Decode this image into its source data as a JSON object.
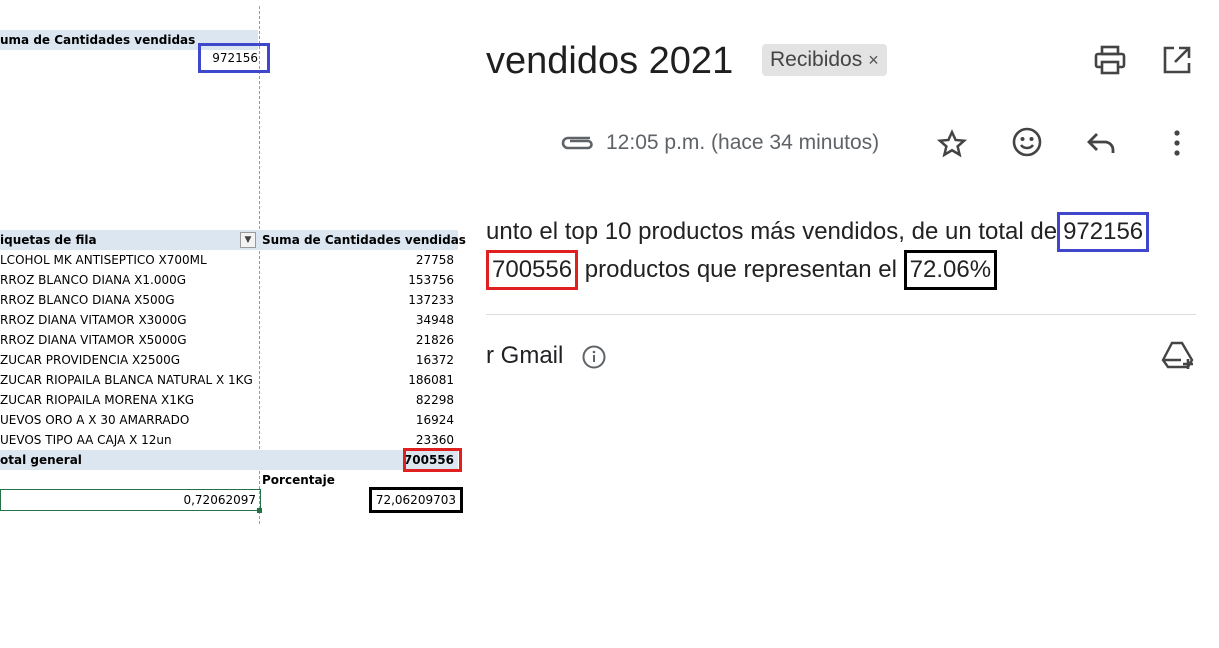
{
  "excel": {
    "top_header": "uma de Cantidades vendidas",
    "top_value": "972156",
    "pivot_header_left": "iquetas de fila",
    "pivot_header_right": "Suma de Cantidades vendidas",
    "rows": [
      {
        "label": "LCOHOL MK ANTISEPTICO X700ML",
        "value": "27758"
      },
      {
        "label": "RROZ BLANCO DIANA X1.000G",
        "value": "153756"
      },
      {
        "label": "RROZ BLANCO DIANA X500G",
        "value": "137233"
      },
      {
        "label": "RROZ DIANA VITAMOR X3000G",
        "value": "34948"
      },
      {
        "label": "RROZ DIANA VITAMOR X5000G",
        "value": "21826"
      },
      {
        "label": "ZUCAR PROVIDENCIA X2500G",
        "value": "16372"
      },
      {
        "label": "ZUCAR RIOPAILA BLANCA NATURAL X 1KG",
        "value": "186081"
      },
      {
        "label": "ZUCAR RIOPAILA MORENA X1KG",
        "value": "82298"
      },
      {
        "label": "UEVOS ORO A X 30 AMARRADO",
        "value": "16924"
      },
      {
        "label": "UEVOS TIPO AA CAJA X 12un",
        "value": "23360"
      }
    ],
    "total_label": "otal general",
    "total_value": "700556",
    "porcentaje_label": "Porcentaje",
    "ratio_value": "0,72062097",
    "percent_value": "72,06209703"
  },
  "gmail": {
    "subject": "vendidos 2021",
    "label_chip": "Recibidos",
    "chip_close": "×",
    "time": "12:05 p.m. (hace 34 minutos)",
    "line1_prefix": "unto el top 10 productos más vendidos, de un total de",
    "line1_value": "972156",
    "line2_value": "700556",
    "line2_middle": "productos que representan el",
    "line2_percent": "72.06%",
    "footer_text": "r Gmail"
  }
}
